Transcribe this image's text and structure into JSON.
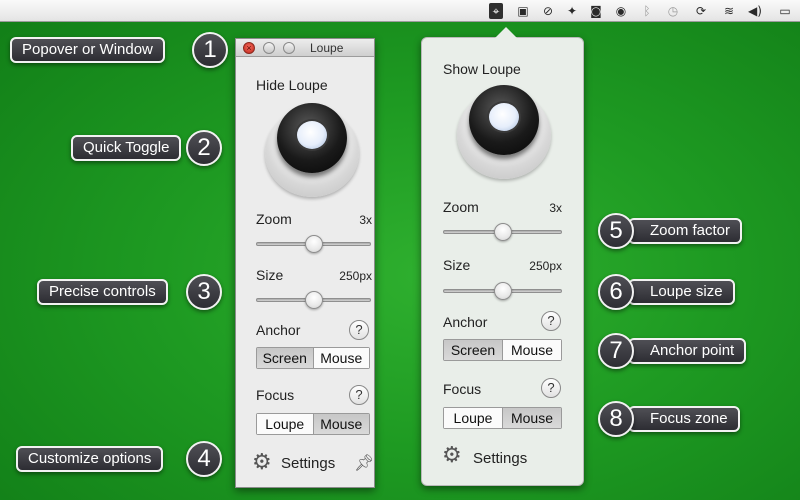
{
  "menubar": {
    "icons": [
      {
        "name": "loupe-icon",
        "glyph": "⌖"
      },
      {
        "name": "screen-icon",
        "glyph": "▣"
      },
      {
        "name": "no-entry-icon",
        "glyph": "⊘"
      },
      {
        "name": "dropbox-icon",
        "glyph": "✦"
      },
      {
        "name": "camera-icon",
        "glyph": "◙"
      },
      {
        "name": "record-icon",
        "glyph": "◉"
      },
      {
        "name": "bluetooth-icon",
        "glyph": "ᛒ"
      },
      {
        "name": "time-machine-icon",
        "glyph": "◷"
      },
      {
        "name": "sync-icon",
        "glyph": "⟳"
      },
      {
        "name": "wifi-icon",
        "glyph": "≋"
      },
      {
        "name": "volume-icon",
        "glyph": "◀)"
      },
      {
        "name": "battery-icon",
        "glyph": "▭"
      }
    ]
  },
  "callouts": {
    "c1": {
      "text": "Popover or Window",
      "number": "1"
    },
    "c2": {
      "text": "Quick Toggle",
      "number": "2"
    },
    "c3": {
      "text": "Precise controls",
      "number": "3"
    },
    "c4": {
      "text": "Customize options",
      "number": "4"
    },
    "c5": {
      "text": "Zoom factor",
      "number": "5"
    },
    "c6": {
      "text": "Loupe size",
      "number": "6"
    },
    "c7": {
      "text": "Anchor point",
      "number": "7"
    },
    "c8": {
      "text": "Focus zone",
      "number": "8"
    }
  },
  "window": {
    "title": "Loupe",
    "toggle_label": "Hide Loupe",
    "zoom": {
      "label": "Zoom",
      "value": "3x",
      "level": 0.5
    },
    "size": {
      "label": "Size",
      "value": "250px",
      "level": 0.5
    },
    "anchor": {
      "label": "Anchor",
      "help": "?",
      "options": [
        "Screen",
        "Mouse"
      ],
      "selected": "Screen"
    },
    "focus": {
      "label": "Focus",
      "help": "?",
      "options": [
        "Loupe",
        "Mouse"
      ],
      "selected": "Mouse"
    },
    "settings_label": "Settings",
    "pin_icon": "pin-icon"
  },
  "popover": {
    "toggle_label": "Show Loupe",
    "zoom": {
      "label": "Zoom",
      "value": "3x",
      "level": 0.5
    },
    "size": {
      "label": "Size",
      "value": "250px",
      "level": 0.5
    },
    "anchor": {
      "label": "Anchor",
      "help": "?",
      "options": [
        "Screen",
        "Mouse"
      ],
      "selected": "Screen"
    },
    "focus": {
      "label": "Focus",
      "help": "?",
      "options": [
        "Loupe",
        "Mouse"
      ],
      "selected": "Mouse"
    },
    "settings_label": "Settings"
  }
}
